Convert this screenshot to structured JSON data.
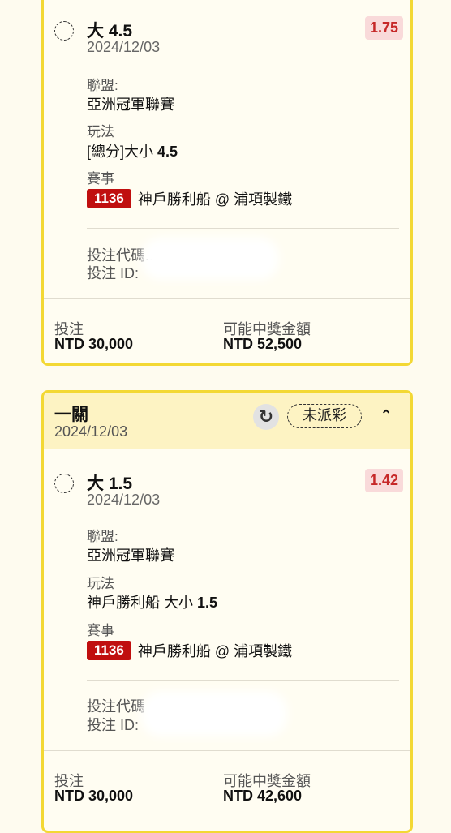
{
  "bets": [
    {
      "selection": {
        "name": "大",
        "line": "4.5",
        "date": "2024/12/03",
        "odds": "1.75"
      },
      "league_label": "聯盟:",
      "league": "亞洲冠軍聯賽",
      "market_label": "玩法",
      "market_prefix": "[總分]大小",
      "market_line": "4.5",
      "event_label": "賽事",
      "event_num": "1136",
      "event_name": "神戶勝利船 @ 浦項製鐵",
      "code_label": "投注代碼..",
      "id_label": "投注 ID:",
      "stake_label": "投注",
      "stake": "NTD 30,000",
      "payout_label": "可能中獎金額",
      "payout": "NTD 52,500"
    },
    {
      "header": {
        "title": "一關",
        "date": "2024/12/03",
        "status": "未派彩"
      },
      "selection": {
        "name": "大",
        "line": "1.5",
        "date": "2024/12/03",
        "odds": "1.42"
      },
      "league_label": "聯盟:",
      "league": "亞洲冠軍聯賽",
      "market_label": "玩法",
      "market_prefix": "神戶勝利船 大小",
      "market_line": "1.5",
      "event_label": "賽事",
      "event_num": "1136",
      "event_name": "神戶勝利船 @ 浦項製鐵",
      "code_label": "投注代碼",
      "id_label": "投注 ID:",
      "stake_label": "投注",
      "stake": "NTD 30,000",
      "payout_label": "可能中獎金額",
      "payout": "NTD 42,600"
    }
  ],
  "icons": {
    "refresh": "refresh-icon",
    "collapse": "chevron-up-icon",
    "radio": "radio-unselected-icon"
  },
  "colors": {
    "accent_border": "#f3d834",
    "header_bg": "#fdf3c3",
    "odds_text": "#c62828",
    "event_badge": "#c00f0f"
  }
}
